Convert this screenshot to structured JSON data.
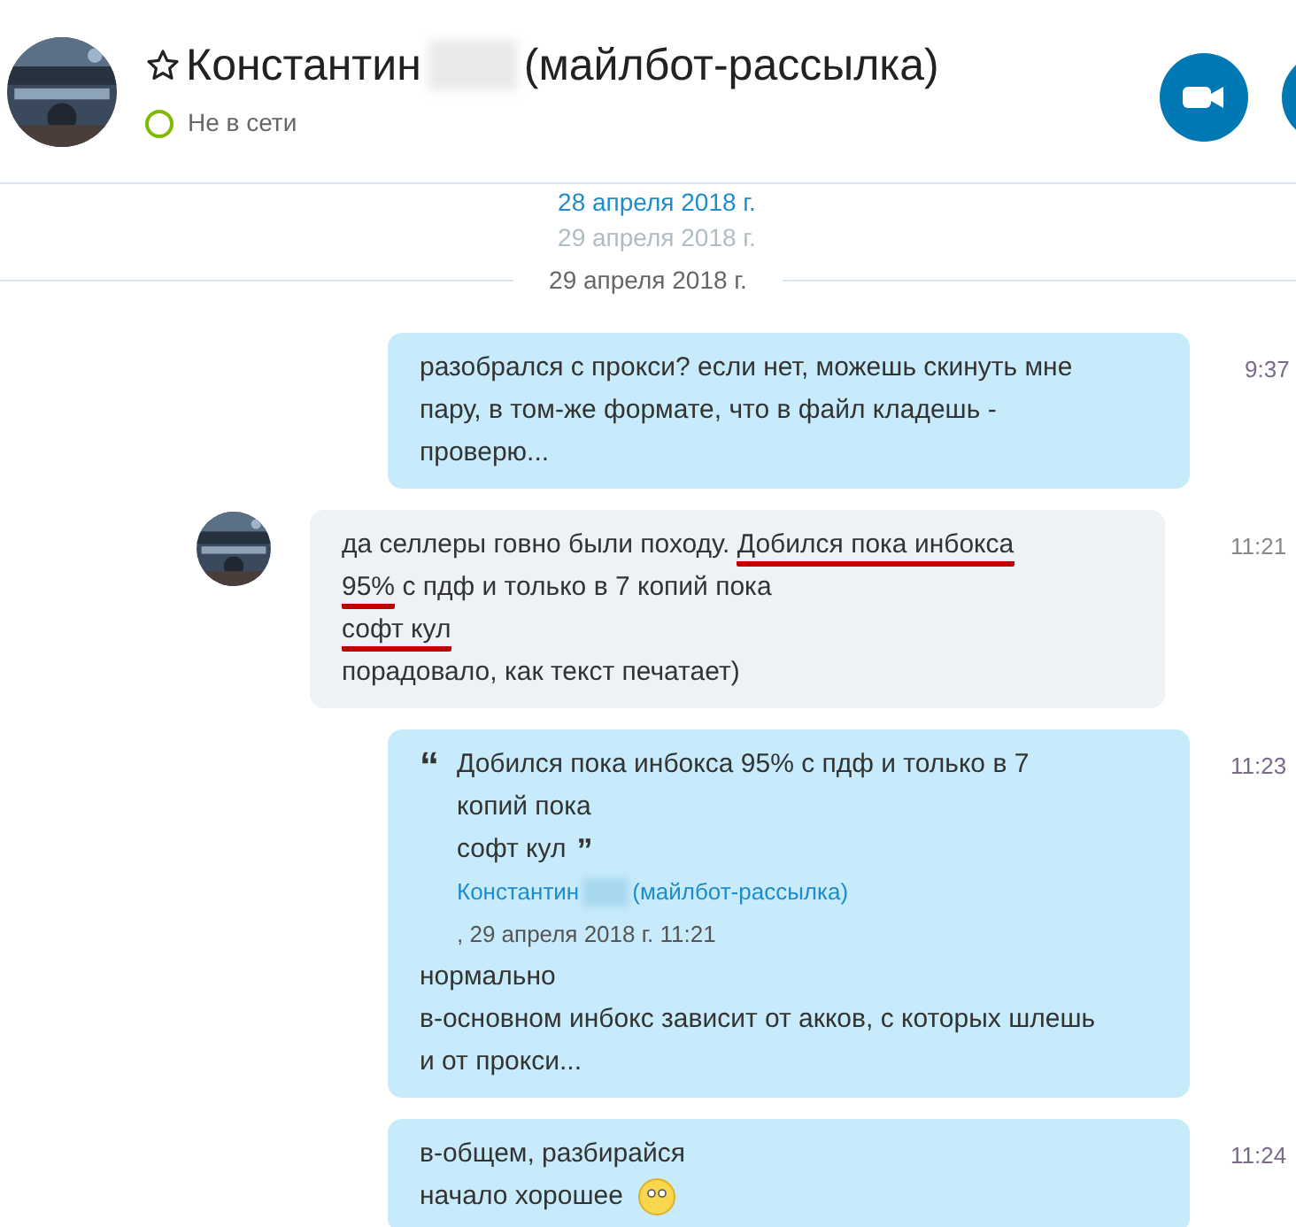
{
  "header": {
    "name_first": "Константин",
    "name_rest": "(майлбот-рассылка)",
    "favorite": false,
    "status": "Не в сети",
    "online": false
  },
  "faded_dates": [
    "28 апреля 2018 г.",
    "29 апреля 2018 г."
  ],
  "date_divider": "29 апреля 2018 г.",
  "messages": [
    {
      "kind": "outgoing",
      "time": "9:37",
      "lines": [
        [
          {
            "text": "разобрался с прокси? если нет, можешь скинуть мне пару, в том-же формате, что в файл кладешь - проверю..."
          }
        ]
      ]
    },
    {
      "kind": "incoming",
      "time": "11:21",
      "lines": [
        [
          {
            "text": "да селлеры говно были походу. "
          },
          {
            "text": "Добился пока инбокса",
            "underlined": true
          }
        ],
        [
          {
            "text": "95%",
            "underlined": true
          },
          {
            "text": " с пдф и только в 7 копий пока"
          }
        ],
        [
          {
            "text": "софт кул",
            "underlined": true
          }
        ],
        [
          {
            "text": "порадовало, как текст печатает)"
          }
        ]
      ]
    },
    {
      "kind": "outgoing",
      "time": "11:23",
      "quote": {
        "open_mark": "“",
        "close_mark": "”",
        "lines": [
          "Добился пока инбокса 95% с пдф и только в 7 копий пока",
          "софт кул"
        ],
        "author_first": "Константин",
        "author_rest": "(майлбот-рассылка)",
        "meta": ", 29 апреля 2018 г. 11:21"
      },
      "lines": [
        [
          {
            "text": "нормально"
          }
        ],
        [
          {
            "text": "в-основном инбокс зависит от акков, с которых шлешь и от прокси..."
          }
        ]
      ]
    },
    {
      "kind": "outgoing",
      "time": "11:24",
      "emoji": true,
      "lines": [
        [
          {
            "text": "в-общем, разбирайся"
          }
        ],
        [
          {
            "text": "начало хорошее"
          }
        ]
      ]
    }
  ]
}
